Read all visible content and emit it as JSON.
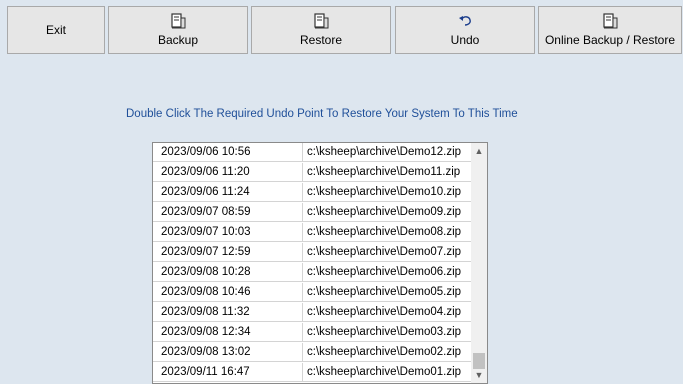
{
  "toolbar": {
    "exit_label": "Exit",
    "backup_label": "Backup",
    "restore_label": "Restore",
    "undo_label": "Undo",
    "online_label": "Online Backup / Restore"
  },
  "instruction": "Double Click The Required Undo Point To Restore Your System To This Time",
  "undo_points": [
    {
      "date": "2023/09/06 10:56",
      "path": "c:\\ksheep\\archive\\Demo12.zip"
    },
    {
      "date": "2023/09/06 11:20",
      "path": "c:\\ksheep\\archive\\Demo11.zip"
    },
    {
      "date": "2023/09/06 11:24",
      "path": "c:\\ksheep\\archive\\Demo10.zip"
    },
    {
      "date": "2023/09/07 08:59",
      "path": "c:\\ksheep\\archive\\Demo09.zip"
    },
    {
      "date": "2023/09/07 10:03",
      "path": "c:\\ksheep\\archive\\Demo08.zip"
    },
    {
      "date": "2023/09/07 12:59",
      "path": "c:\\ksheep\\archive\\Demo07.zip"
    },
    {
      "date": "2023/09/08 10:28",
      "path": "c:\\ksheep\\archive\\Demo06.zip"
    },
    {
      "date": "2023/09/08 10:46",
      "path": "c:\\ksheep\\archive\\Demo05.zip"
    },
    {
      "date": "2023/09/08 11:32",
      "path": "c:\\ksheep\\archive\\Demo04.zip"
    },
    {
      "date": "2023/09/08 12:34",
      "path": "c:\\ksheep\\archive\\Demo03.zip"
    },
    {
      "date": "2023/09/08 13:02",
      "path": "c:\\ksheep\\archive\\Demo02.zip"
    },
    {
      "date": "2023/09/11 16:47",
      "path": "c:\\ksheep\\archive\\Demo01.zip"
    }
  ],
  "icons": {
    "backup": "server-icon",
    "restore": "server-icon",
    "undo": "undo-arrow-icon",
    "online": "server-icon"
  },
  "colors": {
    "background": "#dde6ef",
    "instruction_text": "#1f4f99"
  }
}
